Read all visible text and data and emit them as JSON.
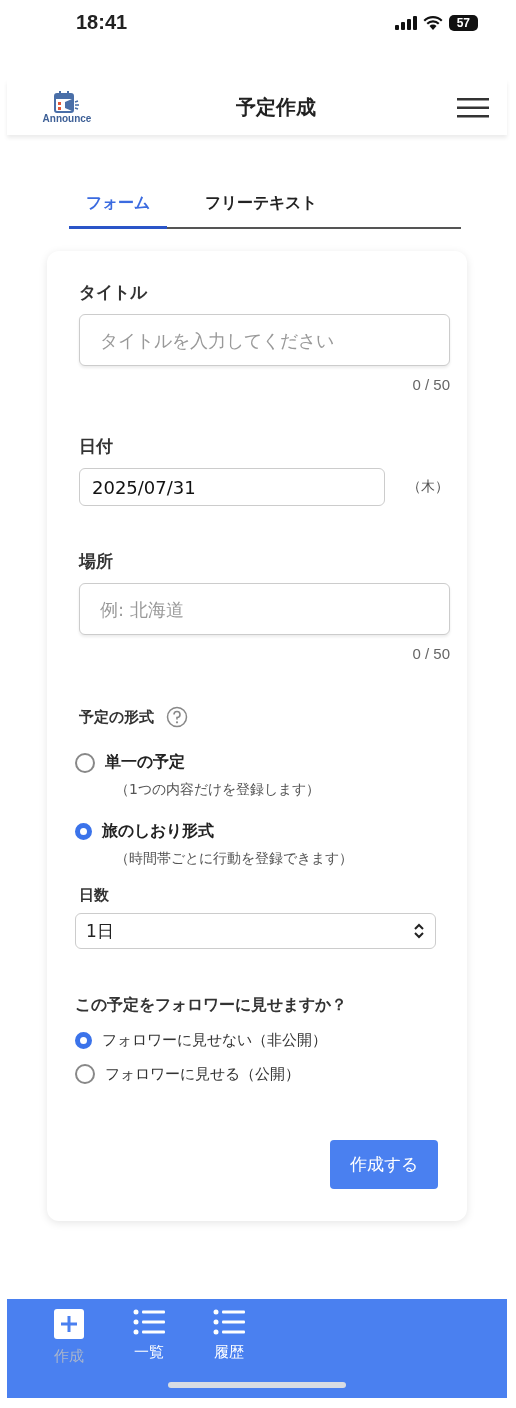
{
  "status_bar": {
    "time": "18:41",
    "battery": "57"
  },
  "header": {
    "logo_text": "Announce",
    "title": "予定作成"
  },
  "tabs": [
    {
      "label": "フォーム",
      "selected": true
    },
    {
      "label": "フリーテキスト",
      "selected": false
    }
  ],
  "form": {
    "title_field": {
      "label": "タイトル",
      "placeholder": "タイトルを入力してください",
      "counter": "0 / 50"
    },
    "date_field": {
      "label": "日付",
      "value": "2025/07/31",
      "weekday": "（木）"
    },
    "place_field": {
      "label": "場所",
      "placeholder": "例: 北海道",
      "counter": "0 / 50"
    },
    "format": {
      "label": "予定の形式",
      "options": [
        {
          "label": "単一の予定",
          "description": "（1つの内容だけを登録します）",
          "selected": false
        },
        {
          "label": "旅のしおり形式",
          "description": "（時間帯ごとに行動を登録できます）",
          "selected": true
        }
      ]
    },
    "days": {
      "label": "日数",
      "value": "1日"
    },
    "visibility": {
      "question": "この予定をフォロワーに見せますか？",
      "options": [
        {
          "label": "フォロワーに見せない（非公開）",
          "selected": true
        },
        {
          "label": "フォロワーに見せる（公開）",
          "selected": false
        }
      ]
    },
    "submit": "作成する"
  },
  "bottom_nav": [
    {
      "label": "作成",
      "kind": "plus",
      "selected": true
    },
    {
      "label": "一覧",
      "kind": "list",
      "selected": false
    },
    {
      "label": "履歴",
      "kind": "list",
      "selected": false
    }
  ]
}
